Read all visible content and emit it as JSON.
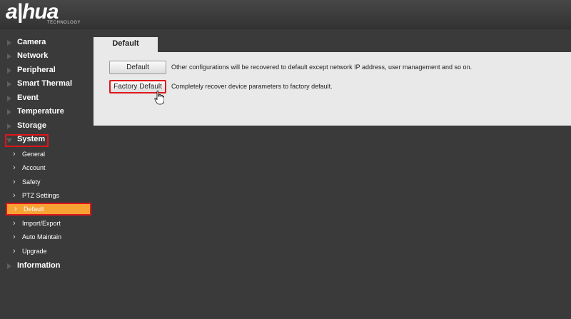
{
  "logo": {
    "text": "a|hua",
    "subtext": "TECHNOLOGY"
  },
  "sidebar": {
    "items": [
      {
        "label": "Camera"
      },
      {
        "label": "Network"
      },
      {
        "label": "Peripheral"
      },
      {
        "label": "Smart Thermal"
      },
      {
        "label": "Event"
      },
      {
        "label": "Temperature"
      },
      {
        "label": "Storage"
      },
      {
        "label": "System"
      }
    ],
    "system_sub": [
      {
        "label": "General"
      },
      {
        "label": "Account"
      },
      {
        "label": "Safety"
      },
      {
        "label": "PTZ Settings"
      },
      {
        "label": "Default"
      },
      {
        "label": "Import/Export"
      },
      {
        "label": "Auto Maintain"
      },
      {
        "label": "Upgrade"
      }
    ],
    "information": "Information"
  },
  "tab": {
    "label": "Default"
  },
  "panel": {
    "default_button": "Default",
    "default_desc": "Other configurations will be recovered to default except network IP address, user management and so on.",
    "factory_button": "Factory Default",
    "factory_desc": "Completely recover device parameters to factory default."
  },
  "colors": {
    "accent": "#f7a233",
    "highlight_border": "#e0161b",
    "background": "#3a3a3a",
    "panel": "#e9e9e9"
  }
}
